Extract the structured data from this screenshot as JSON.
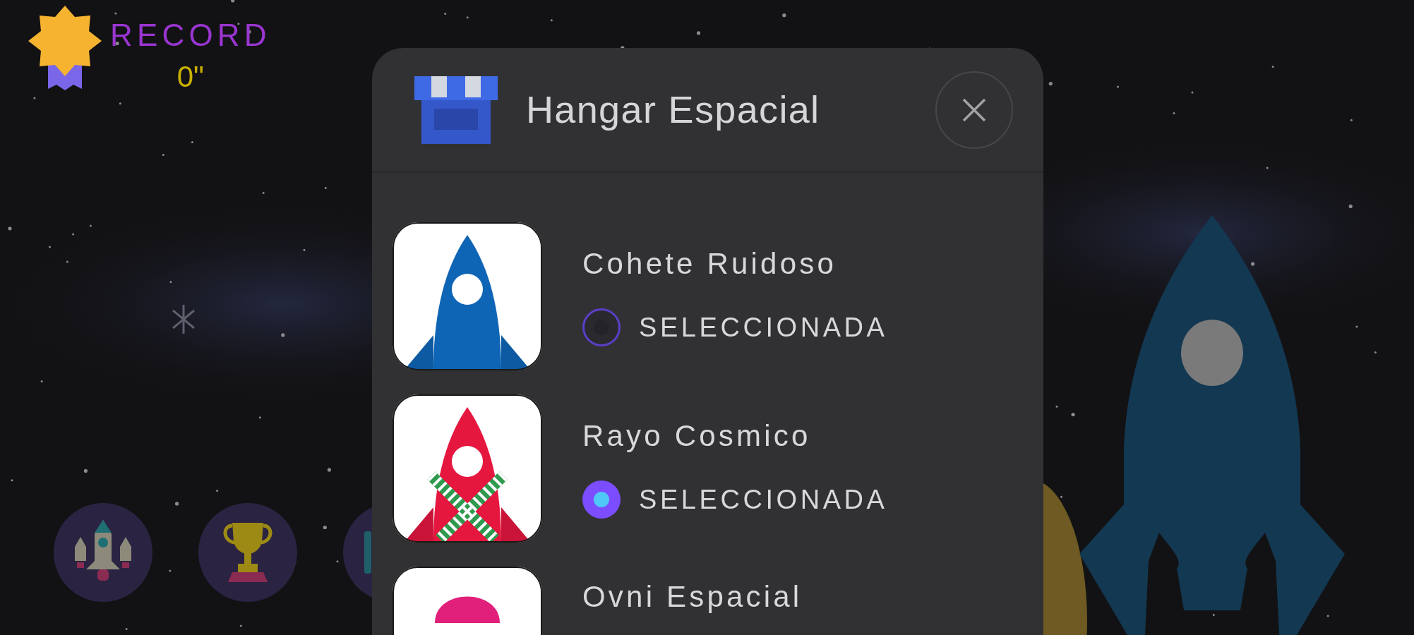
{
  "record": {
    "label": "RECORD",
    "value": "0\""
  },
  "menu_buttons": [
    {
      "kind": "ships"
    },
    {
      "kind": "trophy"
    },
    {
      "kind": "other"
    }
  ],
  "dialog": {
    "title": "Hangar Espacial"
  },
  "ships": [
    {
      "kind": "rocket",
      "name": "Cohete Ruidoso",
      "status": "SELECCIONADA",
      "selected": false
    },
    {
      "kind": "striped_rocket",
      "name": "Rayo Cosmico",
      "status": "SELECCIONADA",
      "selected": true
    },
    {
      "kind": "ufo",
      "name": "Ovni Espacial"
    }
  ]
}
